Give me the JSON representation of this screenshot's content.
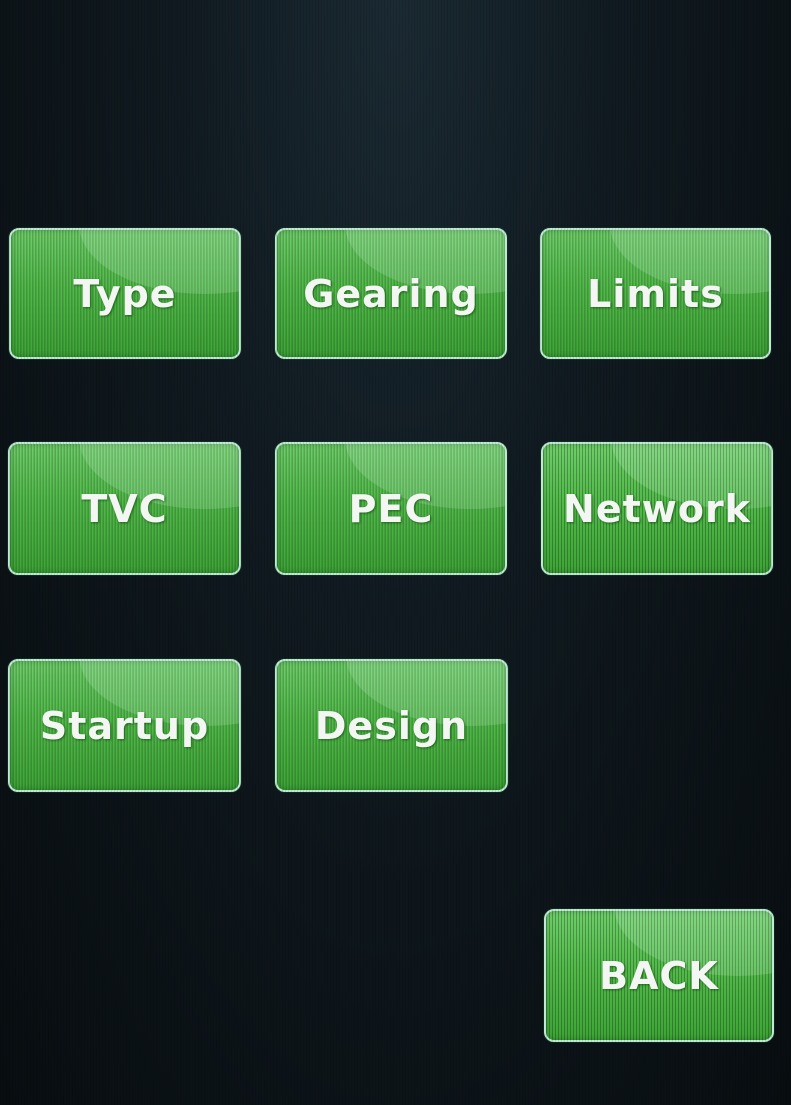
{
  "menu": {
    "buttons": [
      {
        "label": "Type"
      },
      {
        "label": "Gearing"
      },
      {
        "label": "Limits"
      },
      {
        "label": "TVC"
      },
      {
        "label": "PEC"
      },
      {
        "label": "Network"
      },
      {
        "label": "Startup"
      },
      {
        "label": "Design"
      }
    ],
    "back_label": "BACK"
  },
  "colors": {
    "button_green": "#52b94a",
    "button_border": "#bfe9d6",
    "background": "#0a1014",
    "label_text": "#f4f6f4"
  }
}
